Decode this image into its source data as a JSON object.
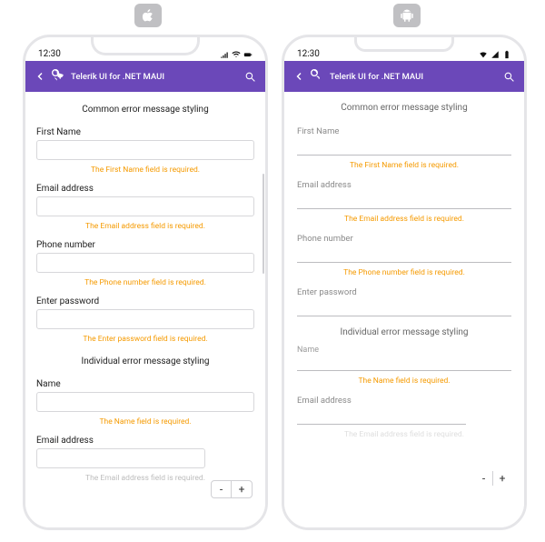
{
  "platform_labels": {
    "ios": "iOS",
    "android": "Android"
  },
  "status": {
    "time": "12:30"
  },
  "appbar": {
    "title": "Telerik UI for .NET MAUI"
  },
  "sections": {
    "common_title": "Common error message styling",
    "individual_title": "Individual error message styling"
  },
  "fields": {
    "first_name": {
      "label": "First Name",
      "error": "The First Name field is required."
    },
    "email": {
      "label": "Email address",
      "error": "The Email address field is required."
    },
    "phone": {
      "label": "Phone number",
      "error": "The Phone number field is required."
    },
    "password": {
      "label": "Enter password",
      "error": "The Enter password field is required."
    },
    "name": {
      "label": "Name",
      "error": "The Name field is required."
    },
    "email2": {
      "label": "Email address",
      "error": "The Email address field is required."
    }
  },
  "android_name_label": "Name",
  "stepper": {
    "minus": "-",
    "plus": "+"
  },
  "colors": {
    "appbar": "#6b48b9",
    "error": "#f59a00"
  }
}
